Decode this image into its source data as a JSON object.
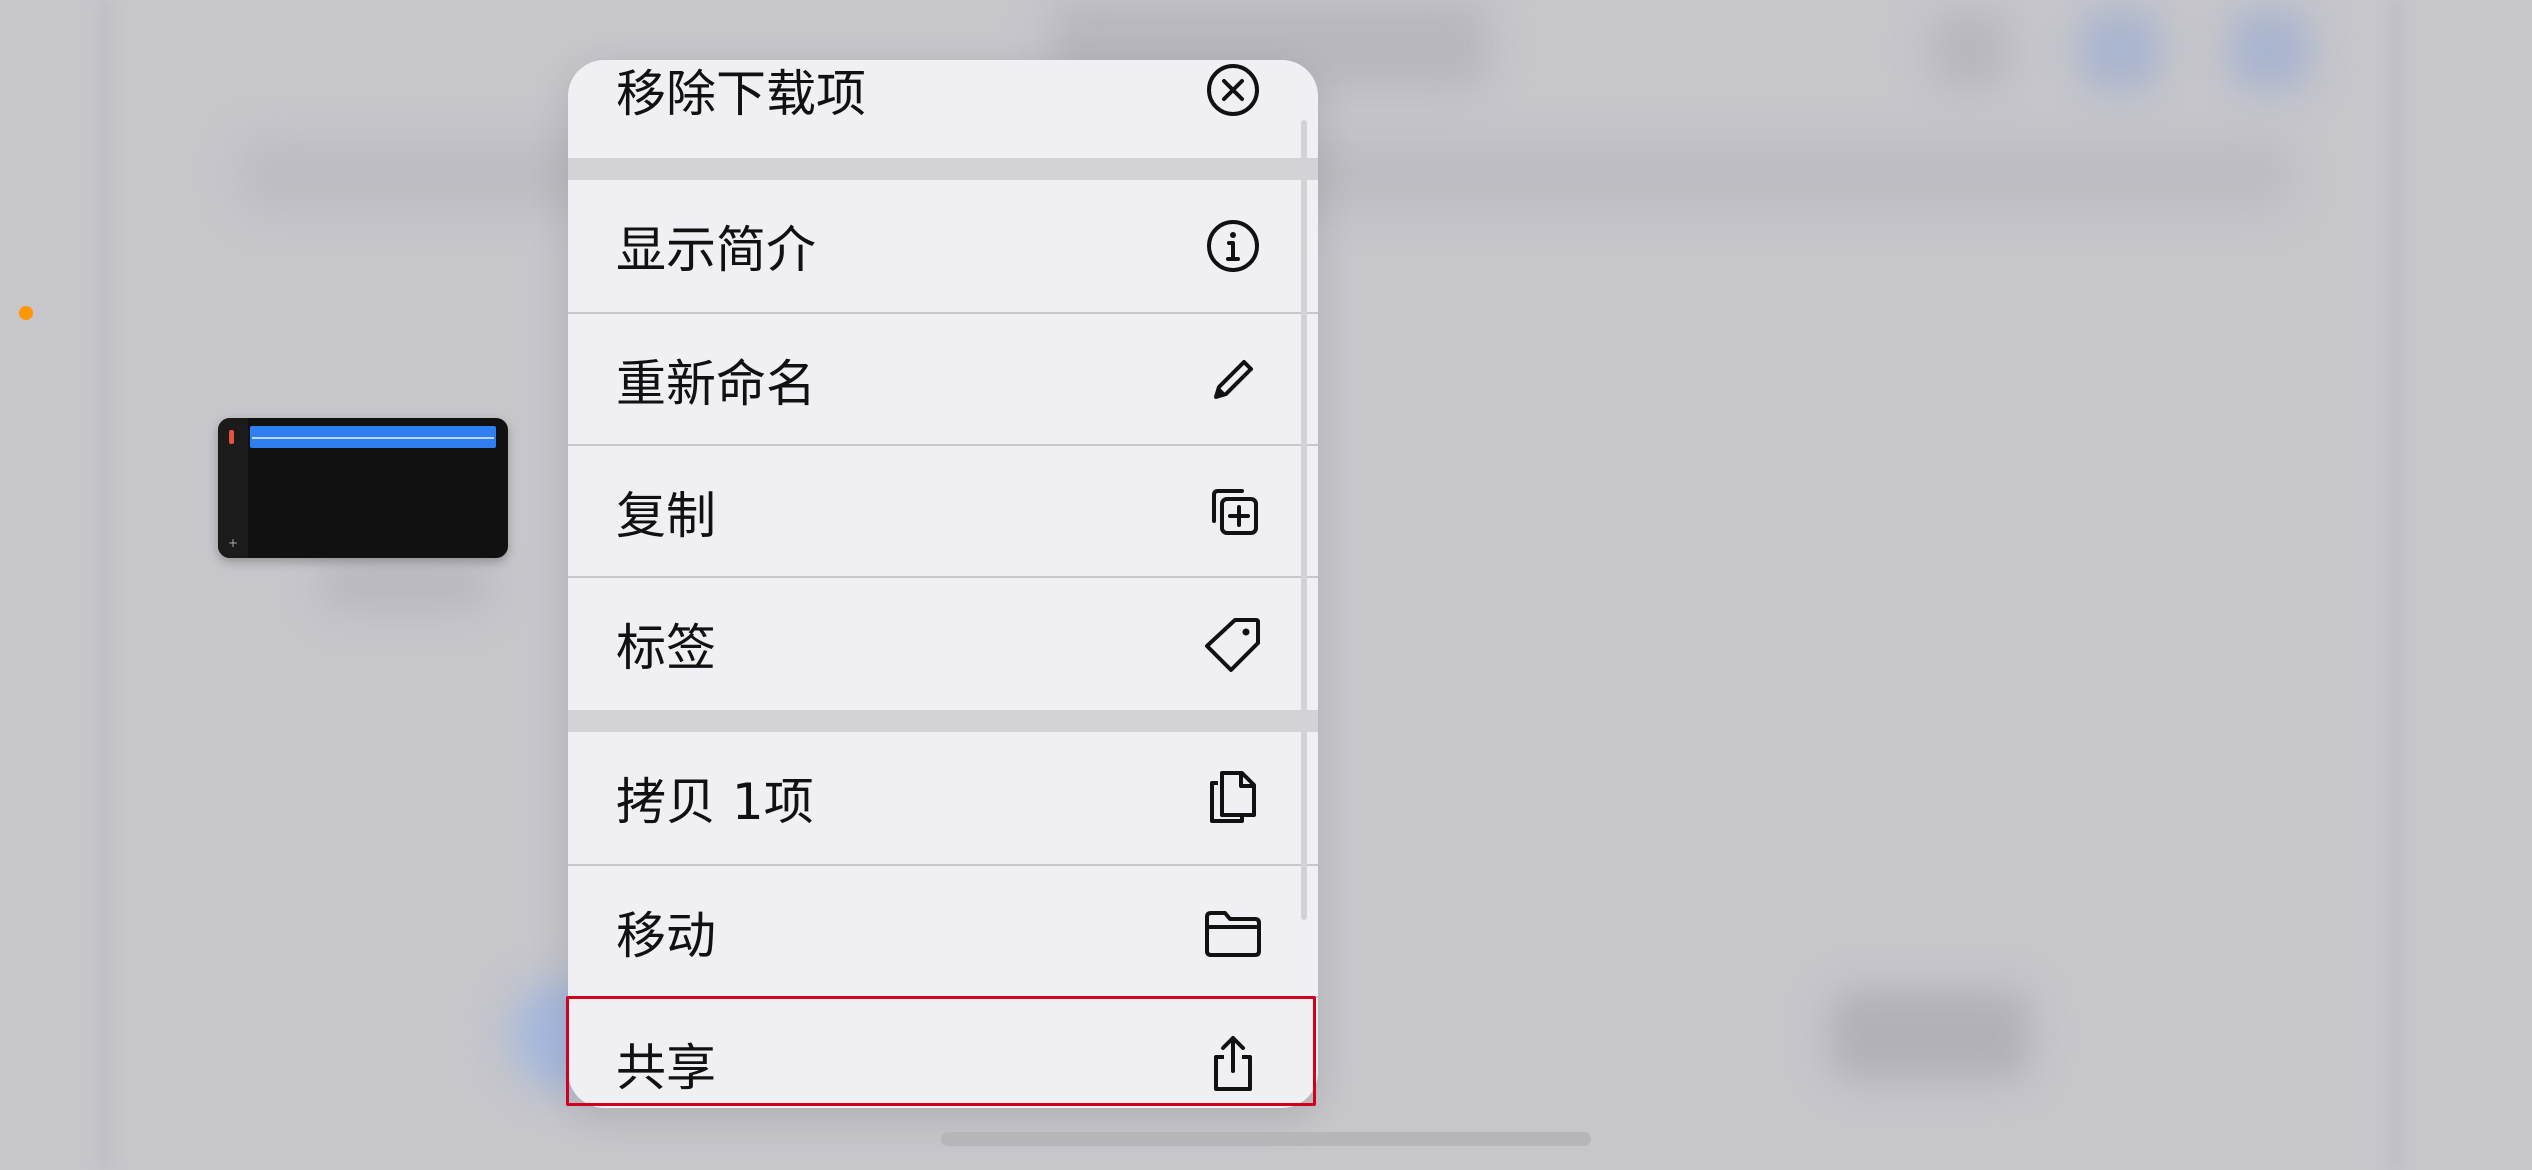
{
  "context_menu": {
    "items": [
      {
        "label": "移除下载项",
        "icon": "xmark-circle-icon"
      },
      {
        "label": "显示简介",
        "icon": "info-circle-icon"
      },
      {
        "label": "重新命名",
        "icon": "pencil-icon"
      },
      {
        "label": "复制",
        "icon": "plus-square-on-square-icon"
      },
      {
        "label": "标签",
        "icon": "tag-icon"
      },
      {
        "label": "拷贝 1项",
        "icon": "doc-on-doc-icon"
      },
      {
        "label": "移动",
        "icon": "folder-icon"
      },
      {
        "label": "共享",
        "icon": "share-icon"
      }
    ]
  },
  "colors": {
    "highlight": "#d0021b",
    "menu_bg": "#efeff4",
    "status_dot": "#ff9500"
  }
}
